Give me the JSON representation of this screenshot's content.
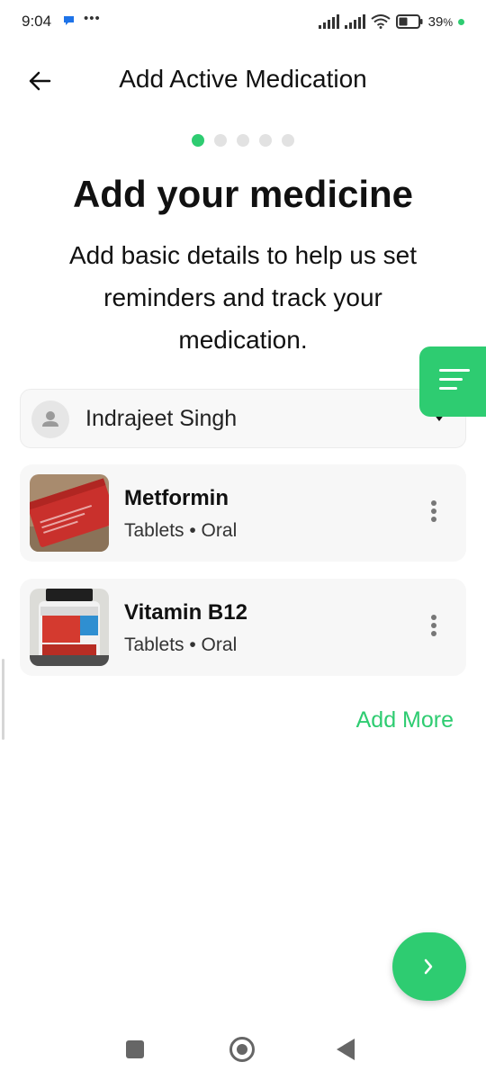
{
  "status_bar": {
    "time": "9:04",
    "dots": "•••",
    "battery_percent": "39",
    "battery_unit": "%"
  },
  "header": {
    "title": "Add Active Medication"
  },
  "stepper": {
    "total_steps": 5,
    "current_step": 1
  },
  "main": {
    "heading": "Add your medicine",
    "subtitle": "Add basic details to help us set reminders and track your medication."
  },
  "patient": {
    "name": "Indrajeet Singh"
  },
  "medications": [
    {
      "name": "Metformin",
      "form": "Tablets",
      "separator": " • ",
      "route": "Oral",
      "meta": "Tablets • Oral"
    },
    {
      "name": "Vitamin B12",
      "form": "Tablets",
      "separator": " • ",
      "route": "Oral",
      "meta": "Tablets • Oral"
    }
  ],
  "actions": {
    "add_more_label": "Add More"
  },
  "colors": {
    "accent": "#2ecc71",
    "card_bg": "#f7f7f7",
    "text": "#111111"
  },
  "icons": {
    "back": "arrow-left-icon",
    "filter": "filter-lines-icon",
    "next": "chevron-right-icon",
    "dropdown": "caret-down-icon",
    "more": "more-vertical-icon"
  }
}
